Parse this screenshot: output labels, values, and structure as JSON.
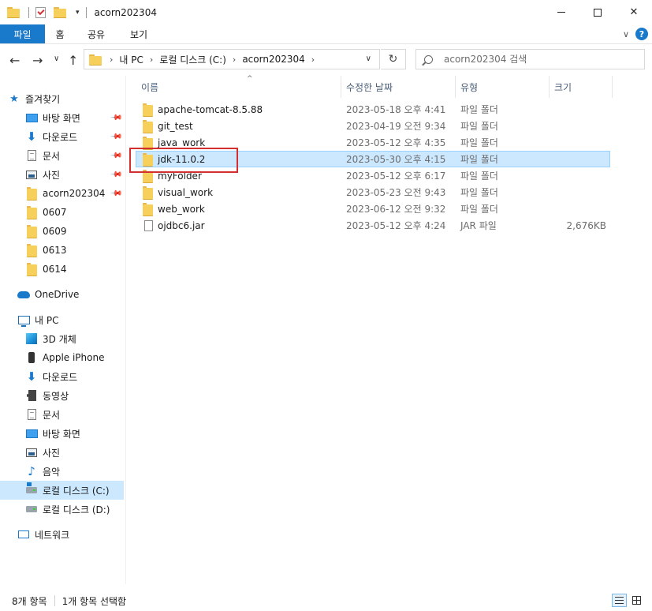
{
  "window": {
    "title": "acorn202304",
    "minimize": "—",
    "maximize": "☐",
    "close": "✕"
  },
  "ribbon": {
    "tabs": [
      "파일",
      "홈",
      "공유",
      "보기"
    ],
    "collapse": "∨",
    "help": "?"
  },
  "address": {
    "crumbs": [
      "내 PC",
      "로컬 디스크 (C:)",
      "acorn202304"
    ],
    "search_placeholder": "acorn202304 검색"
  },
  "sidebar": {
    "quick_access": "즐겨찾기",
    "quick_items": [
      {
        "label": "바탕 화면",
        "icon": "desktop-icon",
        "pinned": true
      },
      {
        "label": "다운로드",
        "icon": "download-icon",
        "pinned": true
      },
      {
        "label": "문서",
        "icon": "document-icon",
        "pinned": true
      },
      {
        "label": "사진",
        "icon": "pictures-icon",
        "pinned": true
      },
      {
        "label": "acorn202304",
        "icon": "folder-icon",
        "pinned": true
      },
      {
        "label": "0607",
        "icon": "folder-icon",
        "pinned": false
      },
      {
        "label": "0609",
        "icon": "folder-icon",
        "pinned": false
      },
      {
        "label": "0613",
        "icon": "folder-icon",
        "pinned": false
      },
      {
        "label": "0614",
        "icon": "folder-icon",
        "pinned": false
      }
    ],
    "onedrive": "OneDrive",
    "this_pc": "내 PC",
    "pc_items": [
      {
        "label": "3D 개체",
        "icon": "3d-objects-icon"
      },
      {
        "label": "Apple iPhone",
        "icon": "phone-icon"
      },
      {
        "label": "다운로드",
        "icon": "download-icon"
      },
      {
        "label": "동영상",
        "icon": "video-icon"
      },
      {
        "label": "문서",
        "icon": "document-icon"
      },
      {
        "label": "바탕 화면",
        "icon": "desktop-icon"
      },
      {
        "label": "사진",
        "icon": "pictures-icon"
      },
      {
        "label": "음악",
        "icon": "music-icon"
      },
      {
        "label": "로컬 디스크 (C:)",
        "icon": "drive-c-icon",
        "selected": true
      },
      {
        "label": "로컬 디스크 (D:)",
        "icon": "drive-d-icon"
      }
    ],
    "network": "네트워크"
  },
  "columns": {
    "name": "이름",
    "date": "수정한 날짜",
    "type": "유형",
    "size": "크기",
    "sort_indicator": "^"
  },
  "files": [
    {
      "name": "apache-tomcat-8.5.88",
      "date": "2023-05-18 오후 4:41",
      "type": "파일 폴더",
      "size": "",
      "kind": "folder"
    },
    {
      "name": "git_test",
      "date": "2023-04-19 오전 9:34",
      "type": "파일 폴더",
      "size": "",
      "kind": "folder"
    },
    {
      "name": "java_work",
      "date": "2023-05-12 오후 4:35",
      "type": "파일 폴더",
      "size": "",
      "kind": "folder"
    },
    {
      "name": "jdk-11.0.2",
      "date": "2023-05-30 오후 4:15",
      "type": "파일 폴더",
      "size": "",
      "kind": "folder",
      "selected": true
    },
    {
      "name": "myFolder",
      "date": "2023-05-12 오후 6:17",
      "type": "파일 폴더",
      "size": "",
      "kind": "folder"
    },
    {
      "name": "visual_work",
      "date": "2023-05-23 오전 9:43",
      "type": "파일 폴더",
      "size": "",
      "kind": "folder"
    },
    {
      "name": "web_work",
      "date": "2023-06-12 오전 9:32",
      "type": "파일 폴더",
      "size": "",
      "kind": "folder"
    },
    {
      "name": "ojdbc6.jar",
      "date": "2023-05-12 오후 4:24",
      "type": "JAR 파일",
      "size": "2,676KB",
      "kind": "file"
    }
  ],
  "status": {
    "item_count": "8개 항목",
    "selected": "1개 항목 선택함"
  },
  "colors": {
    "accent": "#1979ca",
    "selection": "#cce8ff",
    "highlight_box": "#d32f2f"
  }
}
